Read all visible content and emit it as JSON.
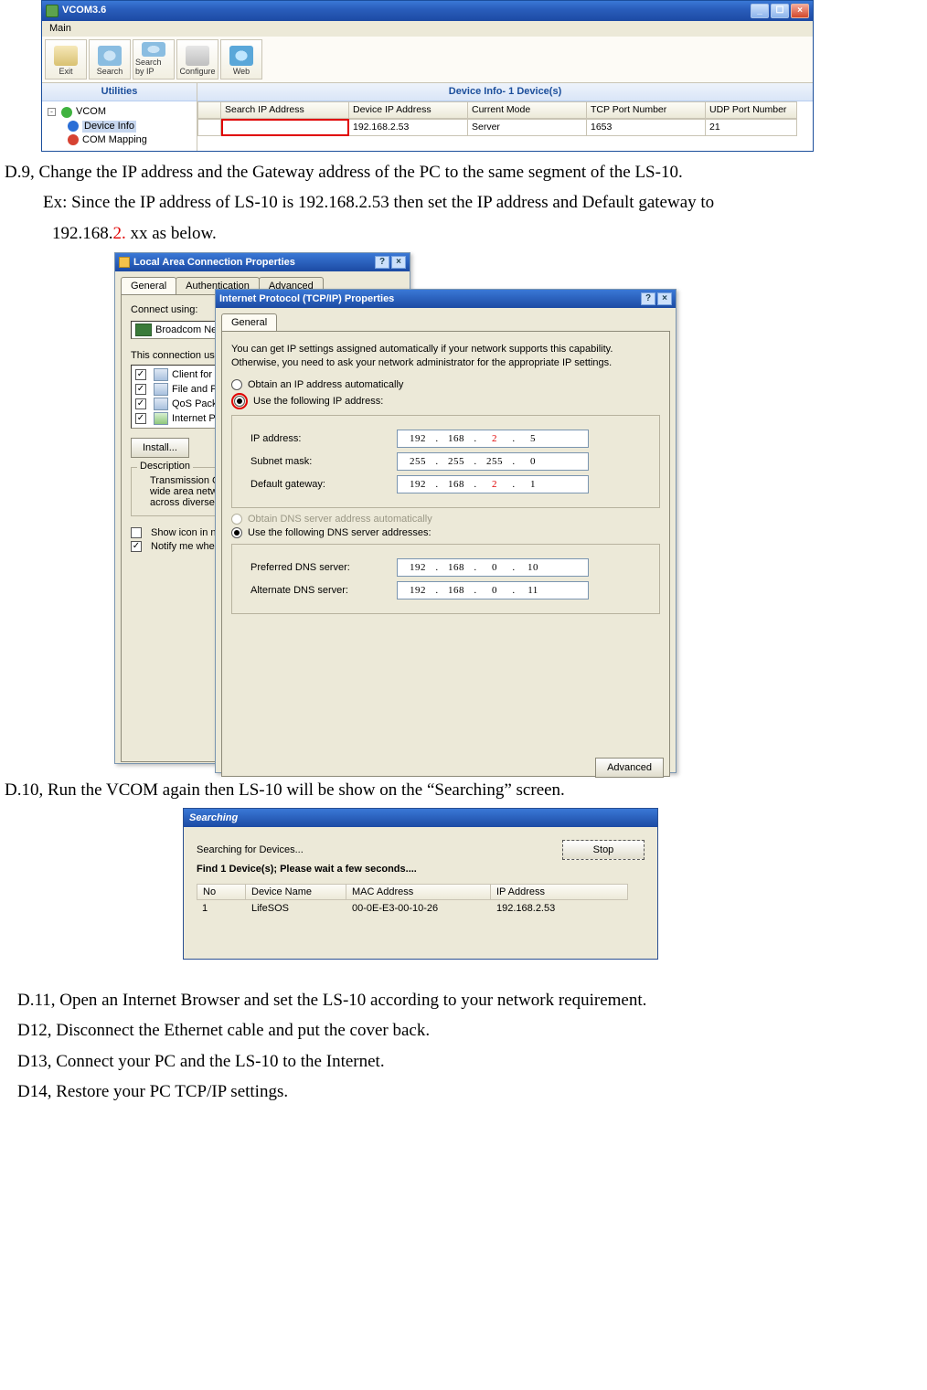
{
  "vcom": {
    "title": "VCOM3.6",
    "menu": "Main",
    "toolbar": {
      "exit": "Exit",
      "search": "Search",
      "sip": "Search by IP",
      "cfg": "Configure",
      "web": "Web"
    },
    "left_header": "Utilities",
    "right_header": "Device Info- 1 Device(s)",
    "tree": {
      "root": "VCOM",
      "a": "Device Info",
      "b": "COM Mapping"
    },
    "cols": {
      "c1": "Search IP Address",
      "c2": "Device IP Address",
      "c3": "Current Mode",
      "c4": "TCP Port Number",
      "c5": "UDP Port Number"
    },
    "row": {
      "c1": "",
      "c2": "192.168.2.53",
      "c3": "Server",
      "c4": "1653",
      "c5": "21"
    }
  },
  "text": {
    "d9a": "D.9, Change the IP address and the Gateway address of the PC to the same segment of the LS-10.",
    "d9b_pre": "Ex: Since the IP address of LS-10 is 192.168.2.53 then set the IP address and Default gateway to",
    "d9c_pre": "192.168.",
    "d9c_red": "2.",
    "d9c_post": " xx as below.",
    "d10": "D.10, Run the VCOM again then LS-10 will be show on the “Searching” screen.",
    "d11": "D.11, Open an Internet Browser and set the LS-10 according to your network requirement.",
    "d12": "D12, Disconnect the Ethernet cable and put the cover back.",
    "d13": "D13, Connect your PC and the LS-10 to the Internet.",
    "d14": "D14, Restore your PC TCP/IP settings."
  },
  "lan": {
    "title1": "Local Area Connection Properties",
    "tabs": {
      "g": "General",
      "a": "Authentication",
      "adv": "Advanced"
    },
    "connect_using": "Connect using:",
    "adapter": "Broadcom NetXt",
    "conn_uses": "This connection uses th",
    "items": [
      "Client for Micro",
      "File and Printe",
      "QoS Packet S",
      "Internet Protoc"
    ],
    "install": "Install...",
    "desc_h": "Description",
    "desc": "Transmission Control\nwide area network p\nacross diverse interc",
    "show": "Show icon in notific",
    "notify": "Notify me when this",
    "title2": "Internet Protocol (TCP/IP) Properties",
    "blurb": "You can get IP settings assigned automatically if your network supports this capability. Otherwise, you need to ask your network administrator for the appropriate IP settings.",
    "r_auto": "Obtain an IP address automatically",
    "r_use": "Use the following IP address:",
    "lab_ip": "IP address:",
    "lab_sn": "Subnet mask:",
    "lab_gw": "Default gateway:",
    "ip": {
      "a": "192",
      "b": "168",
      "c": "2",
      "d": "5"
    },
    "sn": {
      "a": "255",
      "b": "255",
      "c": "255",
      "d": "0"
    },
    "gw": {
      "a": "192",
      "b": "168",
      "c": "2",
      "d": "1"
    },
    "r_dns_auto": "Obtain DNS server address automatically",
    "r_dns_use": "Use the following DNS server addresses:",
    "lab_pdns": "Preferred DNS server:",
    "lab_adns": "Alternate DNS server:",
    "pdns": {
      "a": "192",
      "b": "168",
      "c": "0",
      "d": "10"
    },
    "adns": {
      "a": "192",
      "b": "168",
      "c": "0",
      "d": "11"
    },
    "advanced_btn": "Advanced"
  },
  "search": {
    "title": "Searching",
    "msg": "Searching for  Devices...",
    "stop": "Stop",
    "found": "Find 1 Device(s);  Please wait a few seconds....",
    "cols": {
      "no": "No",
      "name": "Device Name",
      "mac": "MAC Address",
      "ip": "IP Address"
    },
    "row": {
      "no": "1",
      "name": "LifeSOS",
      "mac": "00-0E-E3-00-10-26",
      "ip": "192.168.2.53"
    }
  }
}
